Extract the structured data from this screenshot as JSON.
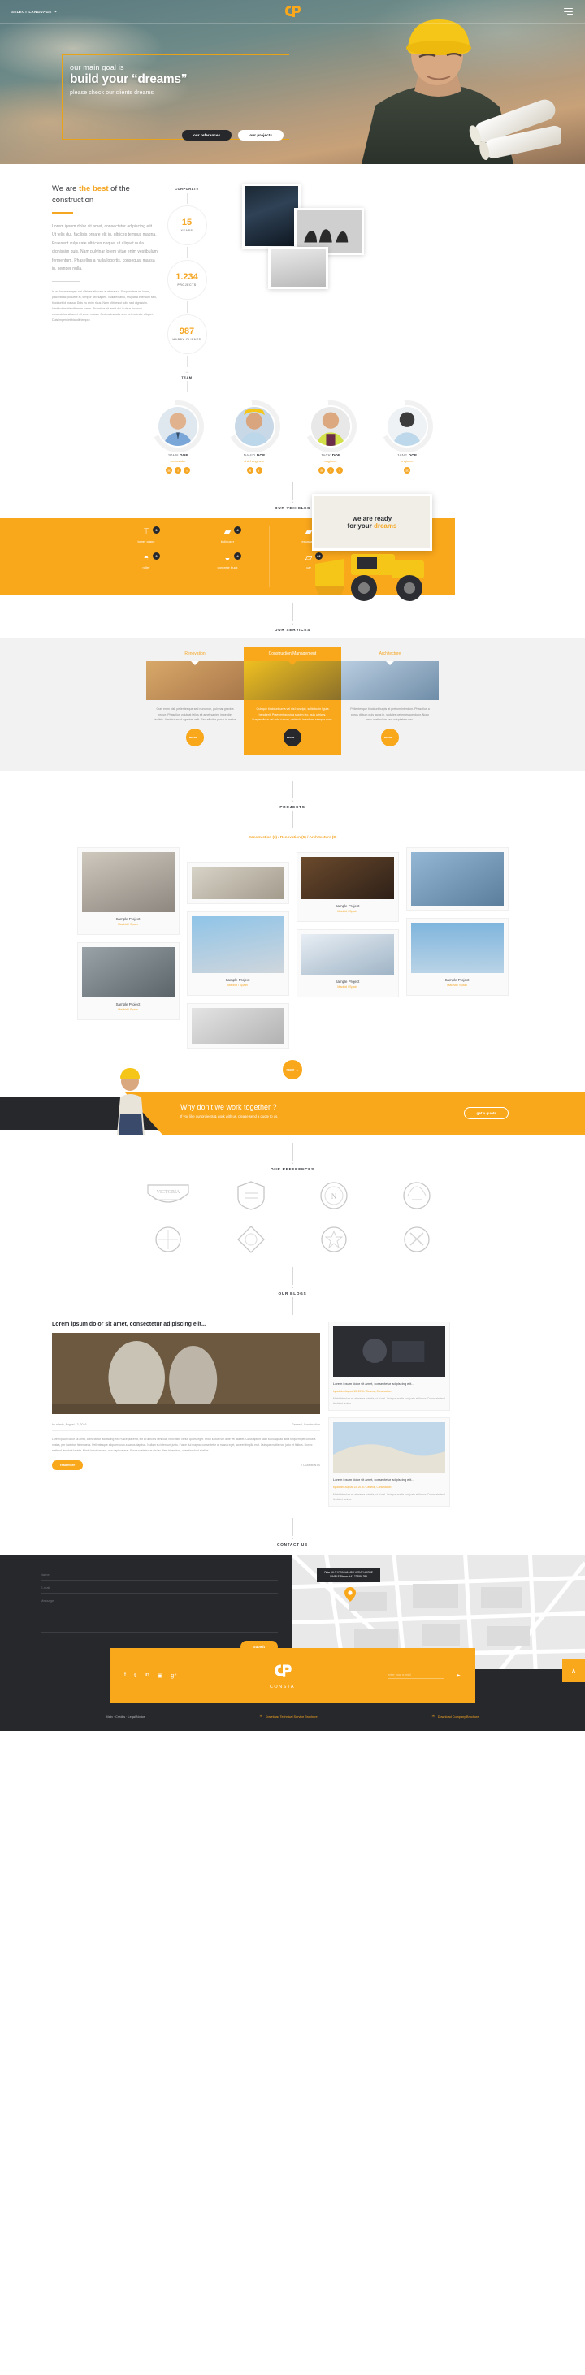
{
  "brand": {
    "name": "CONSTA",
    "accent": "#f9a71b",
    "dark": "#27282c"
  },
  "header": {
    "language_label": "SELECT LANGUAGE",
    "logo_name": "consta-logo",
    "menu_name": "hamburger-menu"
  },
  "hero": {
    "eyebrow": "our main goal is",
    "title": "build your “dreams”",
    "subtitle": "please check our clients dreams",
    "btn_primary": "our references",
    "btn_secondary": "our projects"
  },
  "about": {
    "label": "CORPORATE",
    "heading_pre": "We are ",
    "heading_accent": "the best",
    "heading_post": " of the construction",
    "paragraph1": "Lorem ipsum dolor sit amet, consectetur adipiscing elit. Ut felis dui, facilisis ornare elit in, ultrices tempus magna. Praesent vulputate ultricies neque, ut aliquet nulla dignissim quis. Nam pulvinar lorem vitae enim vestibulum fermentum. Phasellus a nulla lobortis, consequat massa in, semper nulla.",
    "paragraph2": "In ac lorem semper nisi ultrices aliquam at et massa. Suspendisse mi lorem, placerat ac posuere et, tempor sed sapien. Nulla ex arcu, feugiat a interdum sed, tincidunt id massa. Duis eu enim risus. Nam ultrices ut odio sed dignissim. Vestibulum blandit enim lorem. Phasellus sit amet dui in risus rhoncus consectetur sit amet sit amet massa. Sed malesuada sem vel molestie aliquet. Duis imperdiet blandit tempor.",
    "stats": [
      {
        "value": "15",
        "label": "YEARS"
      },
      {
        "value": "1.234",
        "label": "PROJECTS"
      },
      {
        "value": "987",
        "label": "HAPPY CLIENTS"
      }
    ]
  },
  "team": {
    "label": "TEAM",
    "members": [
      {
        "first": "JOHN ",
        "last": "DOE",
        "role": "co-founder",
        "socials": [
          "✉",
          "f",
          "✉"
        ]
      },
      {
        "first": "DAVID ",
        "last": "DOE",
        "role": "chief engineer",
        "socials": [
          "✉",
          "✉"
        ]
      },
      {
        "first": "JACK ",
        "last": "DOE",
        "role": "engineer",
        "socials": [
          "✉",
          "f",
          "✉"
        ]
      },
      {
        "first": "JANE ",
        "last": "DOE",
        "role": "engineer",
        "socials": [
          "✉"
        ]
      }
    ]
  },
  "vehicles": {
    "label": "OUR VEHICLES",
    "items": [
      {
        "name": "tower crane",
        "count": "3",
        "icon": "tower-crane-icon"
      },
      {
        "name": "bulldozer",
        "count": "4",
        "icon": "bulldozer-icon"
      },
      {
        "name": "excavator",
        "count": "22",
        "icon": "excavator-icon"
      },
      {
        "name": "roller",
        "count": "3",
        "icon": "roller-icon"
      },
      {
        "name": "concrete truck",
        "count": "4",
        "icon": "concrete-truck-icon"
      },
      {
        "name": "car",
        "count": "22",
        "icon": "car-icon"
      }
    ],
    "billboard_line1": "we are ready",
    "billboard_line2": "for your ",
    "billboard_accent": "dreams"
  },
  "services": {
    "label": "OUR SERVICES",
    "tabs": [
      {
        "title": "Renovation",
        "active": false,
        "text": "Cras enim nisl, pellentesque sed nunc non, pulvinar gravida neque. Phasellus volutpat tellus sit amet sapien imperdiet facilisis. Vestibulum id egestas velit. Sed efficitur purus in metus",
        "more": "more →"
      },
      {
        "title": "Construction Management",
        "active": true,
        "text": "Quisque tincidunt urna vel nisl suscipit, sollicitudin ligula hendrerit. Praesent gravida sapien leo, quis ultrices. Suspendisse vel ante rutrum, vehicula interdum, semper nunc.",
        "more": "more →"
      },
      {
        "title": "Architecture",
        "active": false,
        "text": "Pellentesque tincidunt turpis at pretium interdum. Phasellus a purus dictum quis lacus in, sodales pellentesque dolor. Nunc arcu vestibulum sed voluptatem nec.",
        "more": "more →"
      }
    ]
  },
  "projects": {
    "label": "PROJECTS",
    "filters": "Construction (3)  /  Renovation (5)  /  Architecture (8)",
    "card_title": "Sample Project",
    "card_location": "Madrid / Spain",
    "more": "more →",
    "columns": [
      [
        {
          "h": 74
        },
        {
          "h": 62
        }
      ],
      [
        {
          "h": 40
        },
        {
          "h": 70
        },
        {
          "h": 44
        }
      ],
      [
        {
          "h": 52
        },
        {
          "h": 50
        },
        {
          "h": 42
        }
      ],
      [
        {
          "h": 66
        },
        {
          "h": 62
        }
      ]
    ]
  },
  "cta": {
    "heading": "Why don’t we work together ?",
    "text": "If you like our projects & work with us, please send a quote to us.",
    "button": "get a quote"
  },
  "references": {
    "label": "OUR REFERENCES",
    "items": [
      "victoria-badge",
      "shield-badge",
      "circle-crest-badge",
      "laurel-badge",
      "round-seal-badge",
      "diamond-badge",
      "star-crest-badge",
      "tools-badge"
    ]
  },
  "blog": {
    "label": "OUR BLOGS",
    "post": {
      "title": "Lorem ipsum dolor sit amet, consectetur adipiscing elit...",
      "author": "by admin, August 13, 2016",
      "category": "General, Construction",
      "body": "Lorem ipsum dolor sit amet, consectetur adipiscing elit. Fusce placerat, elit at ultricies vehicula, nunc nibh varius quam, eget. Proin luctus non ante vel laoreet. Class aptent taciti sociosqu ad litora torquent per conubia nostra, per inceptos himenaeos. Pellentesque aliquam justo a varius dapibus. Nullam eu interdum justo. Fusce dui magna, consectetur at massa eget, laoreet fringilla erat. Quisque mattis non justo et finibus. Donec eleifend tincidunt lacinia. Morbi in rutrum orci, non dapibus erat. Fusce scelerisque nisl ac diam bibendum, vitae tincidunt a tellus.",
      "read_more": "read more",
      "comments": "2 COMMENTS"
    },
    "side_posts": [
      {
        "title": "Lorem ipsum dolor sit amet, consectetur adipiscing elit...",
        "meta": "by admin, August 13, 2016 / General, Construction",
        "excerpt": "Morbi interdum ex at massa lobortis, ut at nisl. Quisque mattis non justo et finibus. Donec eleifend tincidunt lacinia."
      },
      {
        "title": "Lorem ipsum dolor sit amet, consectetur adipiscing elit...",
        "meta": "by admin, August 13, 2016 / General, Construction",
        "excerpt": "Morbi interdum ex at massa lobortis, ut at nisl. Quisque mattis non justo et finibus. Donec eleifend tincidunt lacinia."
      }
    ]
  },
  "contact": {
    "label": "CONTACT US",
    "fields": [
      {
        "placeholder": "Name",
        "name": "name-field"
      },
      {
        "placeholder": "E-mail",
        "name": "email-field"
      },
      {
        "placeholder": "Message",
        "name": "message-field"
      }
    ],
    "submit": "Submit",
    "map_popup": "Offer V6.0.1/2016/#6 VBB VIGNY-VOGUE SIMPLE\nPhone: +41 733591289"
  },
  "footer": {
    "socials": [
      "f",
      "t",
      "in",
      "▣",
      "g+"
    ],
    "logo_name": "CONSTA",
    "newsletter_placeholder": "enter your e-mail",
    "send_icon": "send-icon",
    "links_left": "Main  ·  Credits  ·  Legal Notice",
    "link_tech": "Download Technical Service Brochure",
    "link_company": "Download Company Brochure",
    "top_icon": "∧"
  }
}
